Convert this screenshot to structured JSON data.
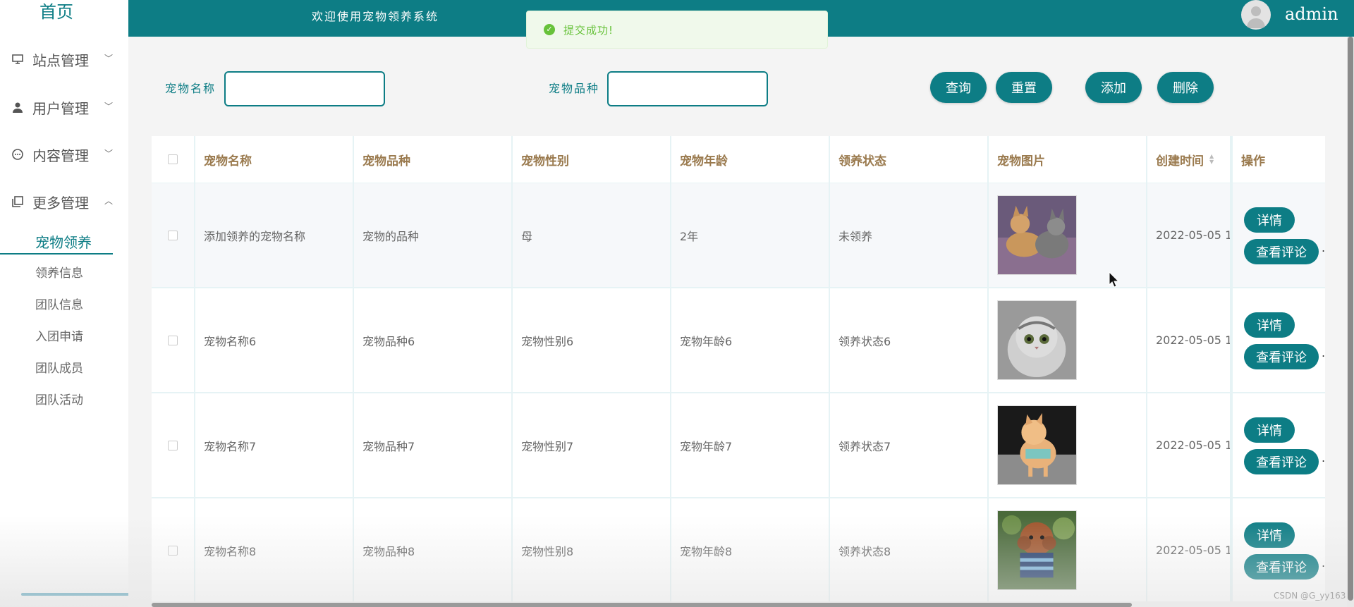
{
  "sidebar": {
    "home": "首页",
    "groups": [
      {
        "label": "站点管理",
        "icon": "monitor-icon",
        "arrow": "﹀"
      },
      {
        "label": "用户管理",
        "icon": "user-icon",
        "arrow": "﹀"
      },
      {
        "label": "内容管理",
        "icon": "chat-icon",
        "arrow": "﹀"
      },
      {
        "label": "更多管理",
        "icon": "copy-icon",
        "arrow": "︿"
      }
    ],
    "sub_items": [
      "宠物领养",
      "领养信息",
      "团队信息",
      "入团申请",
      "团队成员",
      "团队活动"
    ],
    "active_sub": "宠物领养"
  },
  "header": {
    "welcome": "欢迎使用宠物领养系统",
    "username": "admin"
  },
  "toast": {
    "message": "提交成功!",
    "status_color": "#67c23a"
  },
  "search": {
    "name_label": "宠物名称",
    "breed_label": "宠物品种",
    "name_value": "",
    "breed_value": "",
    "query_label": "查询",
    "reset_label": "重置",
    "add_label": "添加",
    "delete_label": "删除"
  },
  "table": {
    "headers": [
      "宠物名称",
      "宠物品种",
      "宠物性别",
      "宠物年龄",
      "领养状态",
      "宠物图片",
      "创建时间",
      "操作"
    ],
    "rows": [
      {
        "name": "添加领养的宠物名称",
        "breed": "宠物的品种",
        "gender": "母",
        "age": "2年",
        "status": "未领养",
        "created": "2022-05-05 1",
        "image": "cats-image"
      },
      {
        "name": "宠物名称6",
        "breed": "宠物品种6",
        "gender": "宠物性别6",
        "age": "宠物年龄6",
        "status": "领养状态6",
        "created": "2022-05-05 1",
        "image": "grey-cat-image"
      },
      {
        "name": "宠物名称7",
        "breed": "宠物品种7",
        "gender": "宠物性别7",
        "age": "宠物年龄7",
        "status": "领养状态7",
        "created": "2022-05-05 1",
        "image": "small-dog-image"
      },
      {
        "name": "宠物名称8",
        "breed": "宠物品种8",
        "gender": "宠物性别8",
        "age": "宠物年龄8",
        "status": "领养状态8",
        "created": "2022-05-05 1",
        "image": "poodle-image"
      }
    ],
    "detail_label": "详情",
    "review_label": "查看评论",
    "overflow_mark": "."
  },
  "watermark": "CSDN @G_yy163",
  "colors": {
    "primary": "#0d7d85",
    "header_text": "#9a7a4e",
    "page_bg": "#f4f4f4"
  }
}
